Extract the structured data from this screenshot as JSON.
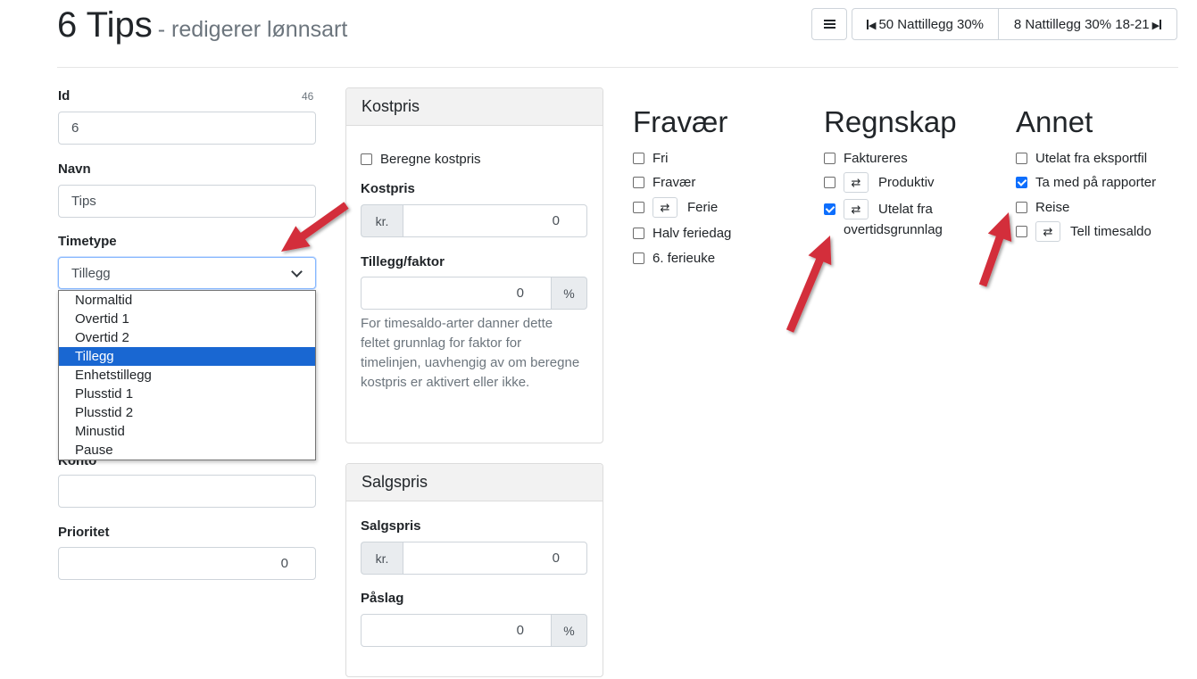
{
  "header": {
    "title": "6 Tips",
    "subtitle": "- redigerer lønnsart",
    "menu_icon": "hamburger-icon",
    "prev_label": "50 Nattillegg 30%",
    "next_label": "8 Nattillegg 30% 18-21"
  },
  "form": {
    "id_label": "Id",
    "id_counter": "46",
    "id_value": "6",
    "navn_label": "Navn",
    "navn_value": "Tips",
    "timetype_label": "Timetype",
    "timetype_value": "Tillegg",
    "timetype_options": [
      "Normaltid",
      "Overtid 1",
      "Overtid 2",
      "Tillegg",
      "Enhetstillegg",
      "Plusstid 1",
      "Plusstid 2",
      "Minustid",
      "Pause"
    ],
    "konto_label": "Konto",
    "konto_value": "",
    "prioritet_label": "Prioritet",
    "prioritet_value": "0"
  },
  "kostpris": {
    "header": "Kostpris",
    "beregne_label": "Beregne kostpris",
    "kostpris_label": "Kostpris",
    "currency": "kr.",
    "kostpris_value": "0",
    "tillegg_label": "Tillegg/faktor",
    "tillegg_value": "0",
    "percent": "%",
    "help_text": "For timesaldo-arter danner dette feltet grunnlag for faktor for timelinjen, uavhengig av om beregne kostpris er aktivert eller ikke."
  },
  "salgspris": {
    "header": "Salgspris",
    "salgspris_label": "Salgspris",
    "currency": "kr.",
    "salgspris_value": "0",
    "paslag_label": "Påslag",
    "paslag_value": "0",
    "percent": "%"
  },
  "fravaer": {
    "title": "Fravær",
    "items": [
      {
        "label": "Fri",
        "checked": false
      },
      {
        "label": "Fravær",
        "checked": false
      },
      {
        "label": "Ferie",
        "checked": false
      },
      {
        "label": "Halv feriedag",
        "checked": false
      },
      {
        "label": "6. ferieuke",
        "checked": false
      }
    ]
  },
  "regnskap": {
    "title": "Regnskap",
    "items": [
      {
        "label": "Faktureres",
        "checked": false
      },
      {
        "label": "Produktiv",
        "checked": false
      },
      {
        "label_line1": "Utelat fra",
        "label_line2": "overtidsgrunnlag",
        "checked": true
      }
    ]
  },
  "annet": {
    "title": "Annet",
    "items": [
      {
        "label": "Utelat fra eksportfil",
        "checked": false
      },
      {
        "label": "Ta med på rapporter",
        "checked": true
      },
      {
        "label": "Reise",
        "checked": false
      },
      {
        "label": "Tell timesaldo",
        "checked": false
      }
    ]
  },
  "icons": {
    "repeat": "⇄",
    "arrow_color": "#d32f3a"
  },
  "colors": {
    "selected_option": "#1967d2",
    "checkbox_checked": "#0d6efd"
  }
}
